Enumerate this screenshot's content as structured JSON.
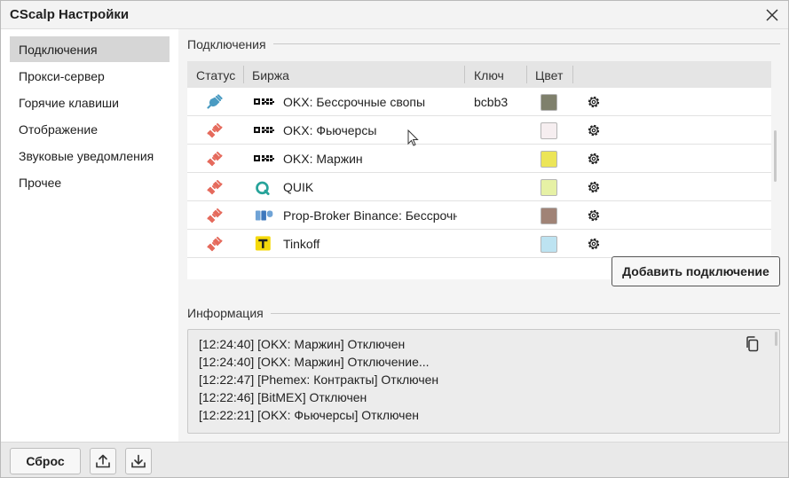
{
  "window": {
    "title": "CScalp Настройки"
  },
  "sidebar": {
    "items": [
      {
        "label": "Подключения",
        "active": true
      },
      {
        "label": "Прокси-сервер"
      },
      {
        "label": "Горячие клавиши"
      },
      {
        "label": "Отображение"
      },
      {
        "label": "Звуковые уведомления"
      },
      {
        "label": "Прочее"
      }
    ]
  },
  "connections": {
    "title": "Подключения",
    "columns": {
      "status": "Статус",
      "exchange": "Биржа",
      "key": "Ключ",
      "color": "Цвет"
    },
    "rows": [
      {
        "status": "connected",
        "logo": "okx-logo",
        "exchange": "OKX: Бессрочные свопы",
        "key": "bcbb3",
        "color": "#7f806c"
      },
      {
        "status": "disconnected",
        "logo": "okx-logo",
        "exchange": "OKX: Фьючерсы",
        "key": "",
        "color": "#f6eef0"
      },
      {
        "status": "disconnected",
        "logo": "okx-logo",
        "exchange": "OKX: Маржин",
        "key": "",
        "color": "#ece558"
      },
      {
        "status": "disconnected",
        "logo": "quik-logo",
        "exchange": "QUIK",
        "key": "",
        "color": "#e6f1a5"
      },
      {
        "status": "disconnected",
        "logo": "prop-broker-logo",
        "exchange": "Prop-Broker Binance: Бессрочные",
        "key": "",
        "color": "#a08376"
      },
      {
        "status": "disconnected",
        "logo": "tinkoff-logo",
        "exchange": "Tinkoff",
        "key": "",
        "color": "#bde3f1"
      }
    ],
    "add_button": "Добавить подключение"
  },
  "info": {
    "title": "Информация",
    "log": [
      "[12:24:40] [OKX: Маржин] Отключен",
      "[12:24:40] [OKX: Маржин] Отключение...",
      "[12:22:47] [Phemex: Контракты] Отключен",
      "[12:22:46] [BitMEX] Отключен",
      "[12:22:21] [OKX: Фьючерсы] Отключен"
    ]
  },
  "footer": {
    "reset": "Сброс"
  },
  "colors": {
    "connected": "#4a9bc2",
    "disconnected": "#e56a5c",
    "active_sidebar": "#d6d6d6"
  },
  "icons": [
    "close-icon",
    "plug-icon",
    "gear-icon",
    "copy-icon",
    "upload-icon",
    "download-icon"
  ]
}
